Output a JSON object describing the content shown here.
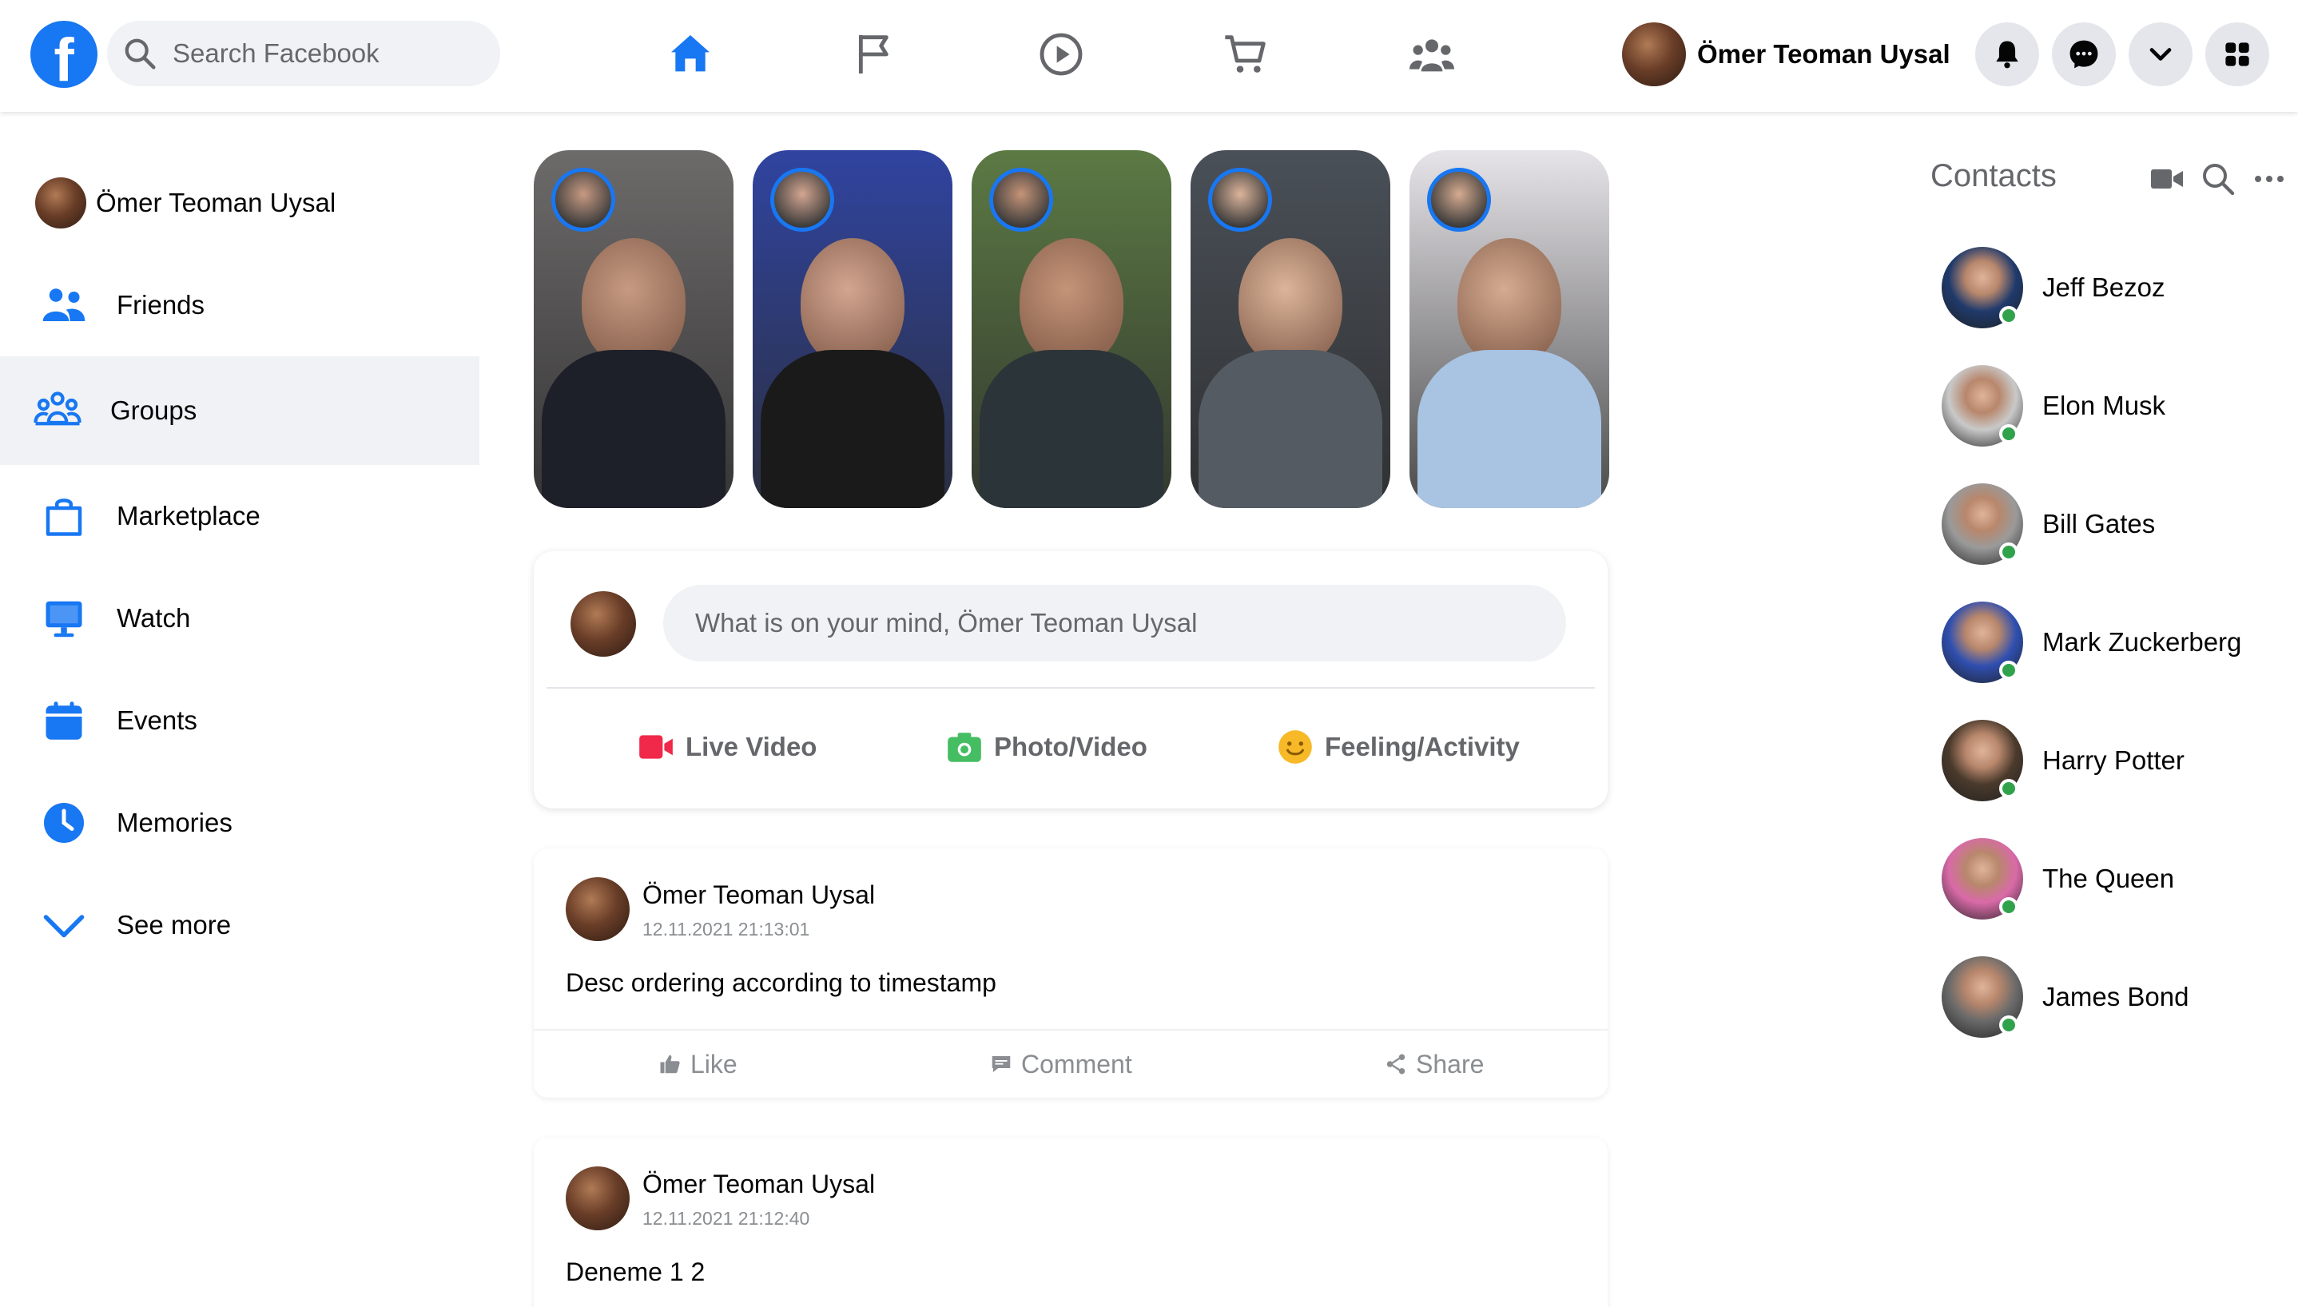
{
  "header": {
    "logo_letter": "f",
    "search_placeholder": "Search Facebook",
    "nav_icons": [
      "home-icon",
      "flag-icon",
      "watch-play-icon",
      "marketplace-cart-icon",
      "groups-icon"
    ],
    "profile_name": "Ömer Teoman Uysal",
    "action_icons": [
      "notifications-bell-icon",
      "messenger-icon",
      "account-chevron-down-icon",
      "menu-grid-icon"
    ],
    "colors": {
      "accent": "#1877f2",
      "icon_grey": "#65676b",
      "button_bg": "#e4e6eb"
    }
  },
  "sidebar": {
    "items": [
      {
        "label": "Ömer Teoman Uysal",
        "icon": "profile-avatar"
      },
      {
        "label": "Friends",
        "icon": "friends-icon"
      },
      {
        "label": "Groups",
        "icon": "groups-icon",
        "active": true
      },
      {
        "label": "Marketplace",
        "icon": "shopping-bag-icon"
      },
      {
        "label": "Watch",
        "icon": "monitor-icon"
      },
      {
        "label": "Events",
        "icon": "calendar-icon"
      },
      {
        "label": "Memories",
        "icon": "clock-icon"
      },
      {
        "label": "See more",
        "icon": "chevron-down-icon"
      }
    ]
  },
  "stories": {
    "count": 5,
    "palettes": [
      {
        "bg": "#6d6a6a",
        "suit": "#1d1f29",
        "face": "#c79a82"
      },
      {
        "bg": "#3044a0",
        "suit": "#1a1a1a",
        "face": "#d3a590"
      },
      {
        "bg": "#5c7a44",
        "suit": "#2b3438",
        "face": "#c59478"
      },
      {
        "bg": "#4a5058",
        "suit": "#555b63",
        "face": "#dcb49a"
      },
      {
        "bg": "#e6e4e8",
        "suit": "#a9c3e2",
        "face": "#d6ab90"
      }
    ]
  },
  "composer": {
    "placeholder": "What is on your mind, Ömer Teoman Uysal",
    "actions": [
      {
        "label": "Live Video",
        "icon": "live-video-icon",
        "color": "#f02849"
      },
      {
        "label": "Photo/Video",
        "icon": "photo-icon",
        "color": "#45bd62"
      },
      {
        "label": "Feeling/Activity",
        "icon": "feeling-smiley-icon",
        "color": "#f7b928"
      }
    ]
  },
  "posts": [
    {
      "author": "Ömer Teoman Uysal",
      "timestamp": "12.11.2021 21:13:01",
      "text": "Desc ordering according to timestamp",
      "actions": [
        "Like",
        "Comment",
        "Share"
      ]
    },
    {
      "author": "Ömer Teoman Uysal",
      "timestamp": "12.11.2021 21:12:40",
      "text": "Deneme 1 2"
    }
  ],
  "contacts": {
    "title": "Contacts",
    "tools": [
      "video-call-icon",
      "search-icon",
      "more-options-icon"
    ],
    "online_color": "#31a24c",
    "list": [
      {
        "name": "Jeff Bezoz",
        "palette": "#1f3a6b"
      },
      {
        "name": "Elon Musk",
        "palette": "#c9c9c9"
      },
      {
        "name": "Bill Gates",
        "palette": "#9a9a9a"
      },
      {
        "name": "Mark Zuckerberg",
        "palette": "#2f4fb0"
      },
      {
        "name": "Harry Potter",
        "palette": "#4a3a2c"
      },
      {
        "name": "The Queen",
        "palette": "#d96aa8"
      },
      {
        "name": "James Bond",
        "palette": "#6a6a6a"
      }
    ]
  }
}
